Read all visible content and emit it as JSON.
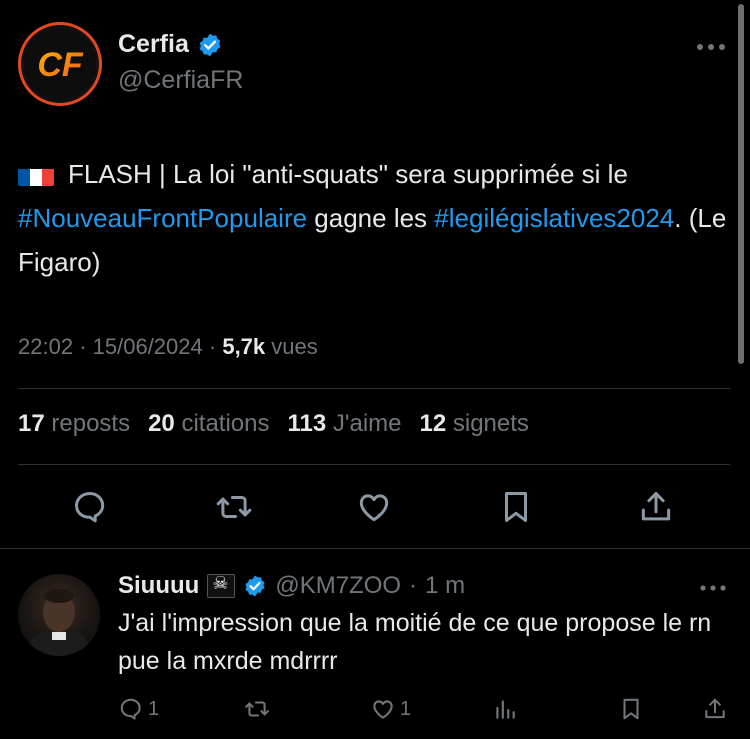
{
  "tweet": {
    "author": {
      "name": "Cerfia",
      "handle": "@CerfiaFR",
      "avatar_text": "CF",
      "verified": true
    },
    "flag": "🇫🇷",
    "text_prefix": "FLASH | La loi \"anti-squats\" sera supprimée si le ",
    "hashtag1": "#NouveauFrontPopulaire",
    "text_mid": " gagne les ",
    "hashtag2": "#legilégislatives2024",
    "text_suffix": ". (Le Figaro)",
    "time": "22:02",
    "date": "15/06/2024",
    "views_count": "5,7k",
    "views_label": "vues",
    "stats": {
      "reposts_count": "17",
      "reposts_label": "reposts",
      "quotes_count": "20",
      "quotes_label": "citations",
      "likes_count": "113",
      "likes_label": "J'aime",
      "bookmarks_count": "12",
      "bookmarks_label": "signets"
    }
  },
  "reply": {
    "name": "Siuuuu",
    "handle": "@KM7ZOO",
    "time": "1 m",
    "text": "J'ai l'impression que la moitié de ce que propose le rn pue la mxrde mdrrrr",
    "replies": "1",
    "likes": "1"
  },
  "colors": {
    "accent": "#1d9bf0",
    "muted": "#71767b",
    "background": "#000000"
  },
  "icons": [
    "more-icon",
    "verified-badge-icon",
    "reply-icon",
    "repost-icon",
    "like-icon",
    "bookmark-icon",
    "share-icon",
    "views-icon",
    "pirate-flag-icon"
  ]
}
